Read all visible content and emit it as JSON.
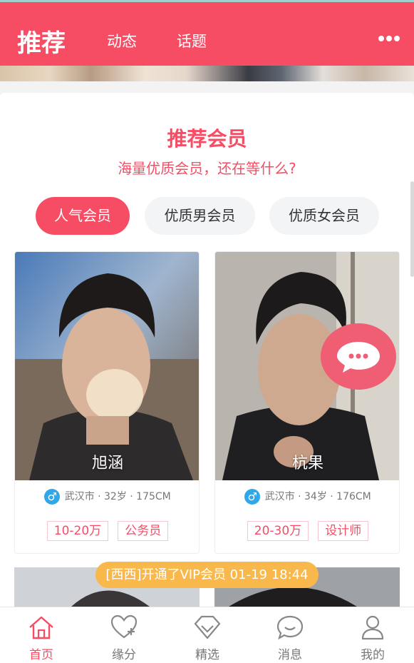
{
  "header": {
    "title": "推荐",
    "tabs": [
      "动态",
      "话题"
    ],
    "more_icon": "more-dots-icon"
  },
  "section": {
    "title": "推荐会员",
    "subtitle": "海量优质会员，还在等什么?"
  },
  "filters": [
    {
      "label": "人气会员",
      "active": true
    },
    {
      "label": "优质男会员",
      "active": false
    },
    {
      "label": "优质女会员",
      "active": false
    }
  ],
  "members": [
    {
      "name": "旭涵",
      "gender_icon": "♂",
      "meta": "武汉市 · 32岁 · 175CM",
      "tags": [
        "10-20万",
        "公务员"
      ]
    },
    {
      "name": "杭果",
      "gender_icon": "♂",
      "meta": "武汉市 · 34岁 · 176CM",
      "tags": [
        "20-30万",
        "设计师"
      ]
    }
  ],
  "toast": "[西西]开通了VIP会员 01-19 18:44",
  "nav": [
    {
      "label": "首页",
      "icon": "home-icon",
      "active": true
    },
    {
      "label": "缘分",
      "icon": "heart-plus-icon",
      "active": false
    },
    {
      "label": "精选",
      "icon": "diamond-icon",
      "active": false
    },
    {
      "label": "消息",
      "icon": "message-icon",
      "active": false
    },
    {
      "label": "我的",
      "icon": "user-icon",
      "active": false
    }
  ],
  "colors": {
    "brand": "#f64d65",
    "toast": "#f9b84b",
    "gender": "#2fa7e8"
  }
}
